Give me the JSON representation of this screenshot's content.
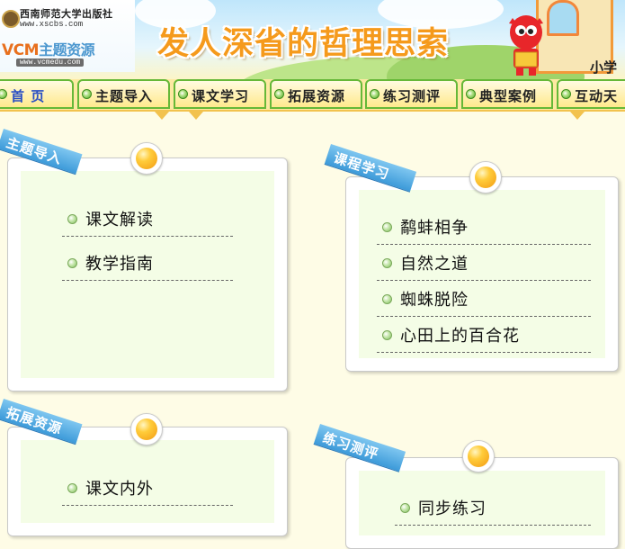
{
  "header": {
    "publisher_name": "西南师范大学出版社",
    "publisher_url": "www.xscbs.com",
    "brand_prefix": "VCM",
    "brand_suffix": "主题资源",
    "brand_url": "www.vcmedu.com",
    "slogan": "发人深省的哲理思索",
    "level_label": "小学"
  },
  "nav": {
    "tabs": [
      {
        "label": "首 页",
        "active": true
      },
      {
        "label": "主题导入"
      },
      {
        "label": "课文学习"
      },
      {
        "label": "拓展资源"
      },
      {
        "label": "练习测评"
      },
      {
        "label": "典型案例"
      },
      {
        "label": "互动天"
      }
    ]
  },
  "panels": {
    "intro": {
      "title": "主题导入",
      "items": [
        "课文解读",
        "教学指南"
      ]
    },
    "lessons": {
      "title": "课程学习",
      "items": [
        "鹬蚌相争",
        "自然之道",
        "蜘蛛脱险",
        "心田上的百合花"
      ]
    },
    "resources": {
      "title": "拓展资源",
      "items": [
        "课文内外"
      ]
    },
    "practice": {
      "title": "练习测评",
      "items": [
        "同步练习"
      ]
    }
  },
  "colors": {
    "nav_border": "#66b838",
    "ribbon": "#3c9ad9",
    "slogan": "#f59a1c",
    "panel_inner": "#f4fde6"
  }
}
